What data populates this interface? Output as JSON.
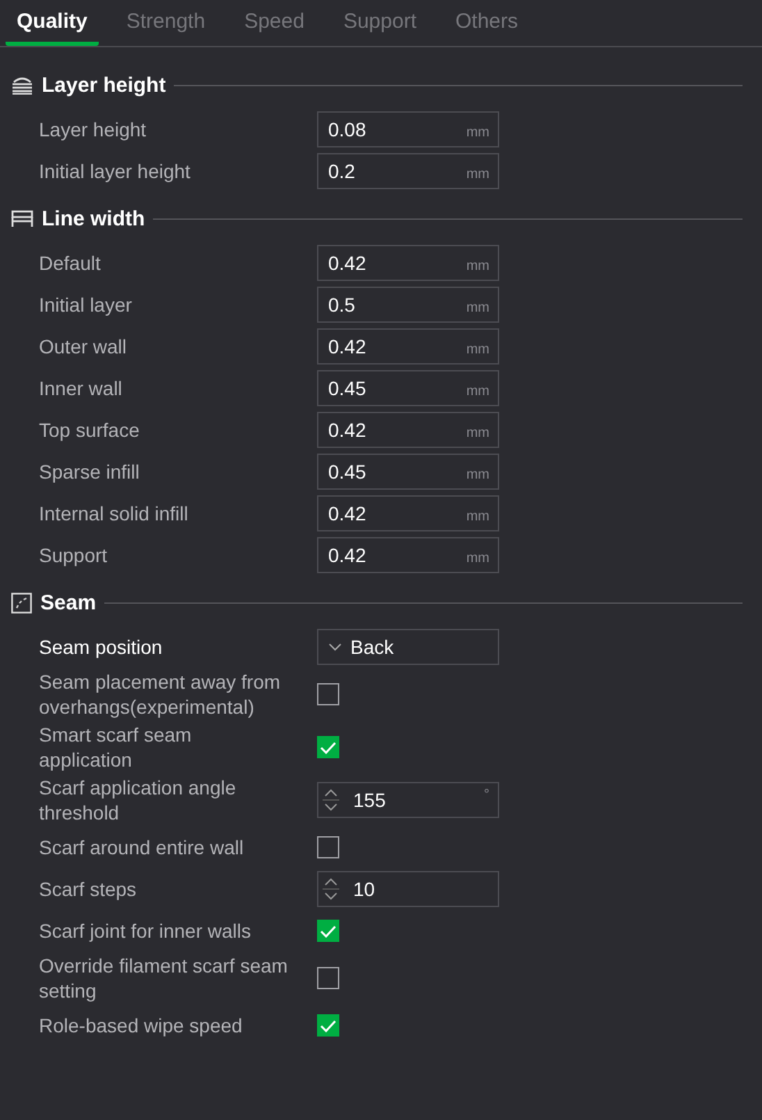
{
  "tabs": [
    {
      "label": "Quality",
      "selected": true
    },
    {
      "label": "Strength",
      "selected": false
    },
    {
      "label": "Speed",
      "selected": false
    },
    {
      "label": "Support",
      "selected": false
    },
    {
      "label": "Others",
      "selected": false
    }
  ],
  "sections": [
    {
      "kind": "layers",
      "title": "Layer height",
      "rows": [
        {
          "kind": "number",
          "label": "Layer height",
          "value": "0.08",
          "unit": "mm",
          "modified": false
        },
        {
          "kind": "number",
          "label": "Initial layer height",
          "value": "0.2",
          "unit": "mm",
          "modified": false
        }
      ]
    },
    {
      "kind": "lines",
      "title": "Line width",
      "rows": [
        {
          "kind": "number",
          "label": "Default",
          "value": "0.42",
          "unit": "mm",
          "modified": false
        },
        {
          "kind": "number",
          "label": "Initial layer",
          "value": "0.5",
          "unit": "mm",
          "modified": false
        },
        {
          "kind": "number",
          "label": "Outer wall",
          "value": "0.42",
          "unit": "mm",
          "modified": false
        },
        {
          "kind": "number",
          "label": "Inner wall",
          "value": "0.45",
          "unit": "mm",
          "modified": false
        },
        {
          "kind": "number",
          "label": "Top surface",
          "value": "0.42",
          "unit": "mm",
          "modified": false
        },
        {
          "kind": "number",
          "label": "Sparse infill",
          "value": "0.45",
          "unit": "mm",
          "modified": false
        },
        {
          "kind": "number",
          "label": "Internal solid infill",
          "value": "0.42",
          "unit": "mm",
          "modified": false
        },
        {
          "kind": "number",
          "label": "Support",
          "value": "0.42",
          "unit": "mm",
          "modified": false
        }
      ]
    },
    {
      "kind": "seam",
      "title": "Seam",
      "rows": [
        {
          "kind": "dropdown",
          "label": "Seam position",
          "value": "Back",
          "modified": true
        },
        {
          "kind": "checkbox",
          "label": "Seam placement away from overhangs(experimental)",
          "checked": false,
          "modified": false
        },
        {
          "kind": "checkbox",
          "label": "Smart scarf seam application",
          "checked": true,
          "modified": false
        },
        {
          "kind": "spin",
          "label": "Scarf application angle threshold",
          "value": "155",
          "unit": "°",
          "modified": false
        },
        {
          "kind": "checkbox",
          "label": "Scarf around entire wall",
          "checked": false,
          "modified": false
        },
        {
          "kind": "spin",
          "label": "Scarf steps",
          "value": "10",
          "modified": false
        },
        {
          "kind": "checkbox",
          "label": "Scarf joint for inner walls",
          "checked": true,
          "modified": false
        },
        {
          "kind": "checkbox",
          "label": "Override filament scarf seam setting",
          "checked": false,
          "modified": false
        },
        {
          "kind": "checkbox",
          "label": "Role-based wipe speed",
          "checked": true,
          "modified": false
        }
      ]
    }
  ]
}
